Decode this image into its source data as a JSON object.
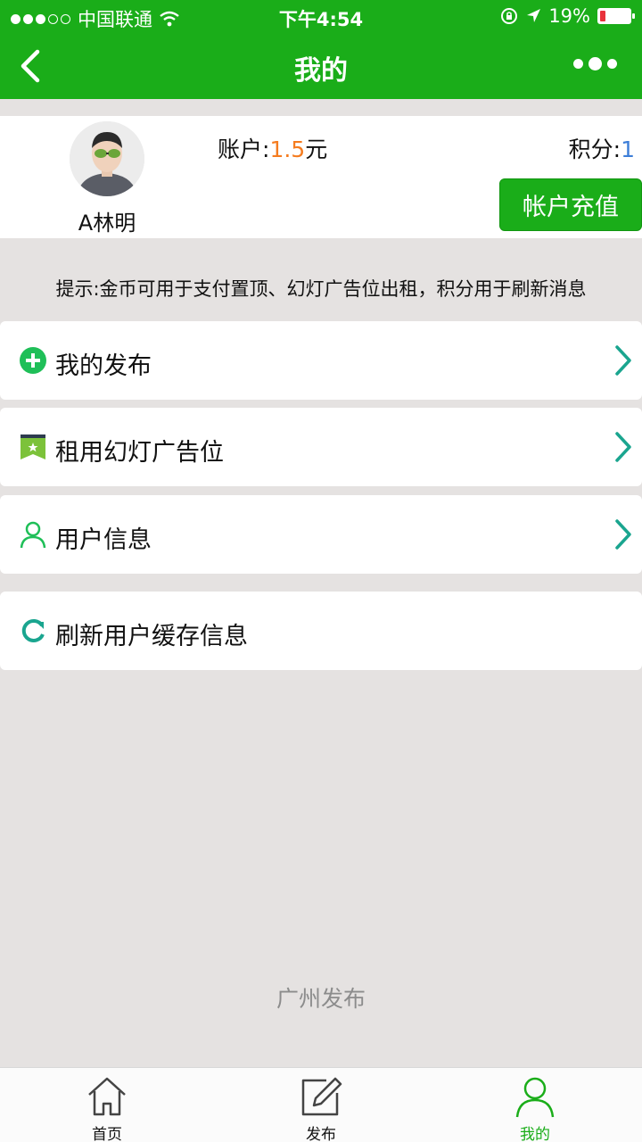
{
  "status_bar": {
    "carrier": "中国联通",
    "time": "下午4:54",
    "battery": "19%"
  },
  "nav": {
    "title": "我的"
  },
  "profile": {
    "username": "A林明",
    "account_label": "账户:",
    "account_value": "1.5",
    "account_unit": "元",
    "points_label": "积分:",
    "points_value": "1",
    "recharge_button": "帐户充值"
  },
  "tip": "提示:金币可用于支付置顶、幻灯广告位出租，积分用于刷新消息",
  "menu": [
    {
      "label": "我的发布",
      "icon": "plus-circle-icon"
    },
    {
      "label": "租用幻灯广告位",
      "icon": "banner-flag-icon"
    },
    {
      "label": "用户信息",
      "icon": "user-icon"
    },
    {
      "label": "刷新用户缓存信息",
      "icon": "refresh-icon"
    }
  ],
  "footer": "广州发布",
  "tabs": [
    {
      "label": "首页",
      "icon": "home-icon"
    },
    {
      "label": "发布",
      "icon": "edit-icon"
    },
    {
      "label": "我的",
      "icon": "person-icon"
    }
  ],
  "colors": {
    "brand_green": "#1aad19",
    "account_value": "#f57c1f",
    "points_value": "#3d7ed8",
    "chevron": "#1aa58f"
  }
}
